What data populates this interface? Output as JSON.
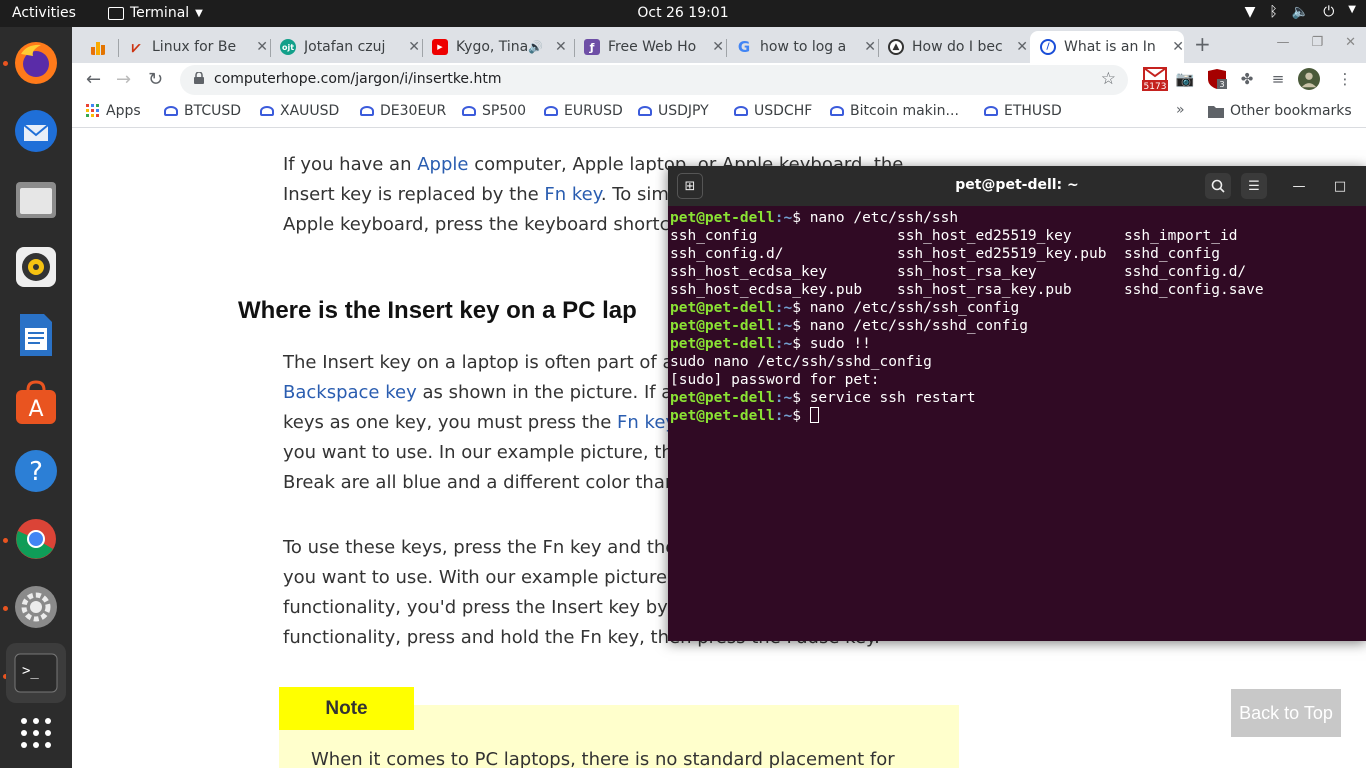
{
  "topbar": {
    "activities": "Activities",
    "app": "Terminal",
    "clock": "Oct 26  19:01"
  },
  "browser": {
    "tabs": [
      {
        "title": "Linux for Be",
        "fav_color": "#c31"
      },
      {
        "title": "Jotafan czuj",
        "fav_color": "#13a08a"
      },
      {
        "title": "Kygo, Tina",
        "fav_color": "#e00"
      },
      {
        "title": "Free Web Ho",
        "fav_color": "#6e4fa6"
      },
      {
        "title": "how to log a",
        "fav_color": "#4285f4"
      },
      {
        "title": "How do I bec",
        "fav_color": "#333"
      },
      {
        "title": "What is an In",
        "fav_color": "#1a4ed8"
      }
    ],
    "url": "computerhope.com/jargon/i/insertke.htm",
    "ext_badge_mail": "5173",
    "ext_badge_shield": "3",
    "bookmarks": [
      "Apps",
      "BTCUSD",
      "XAUUSD",
      "DE30EUR",
      "SP500",
      "EURUSD",
      "USDJPY",
      "USDCHF",
      "Bitcoin makin...",
      "ETHUSD"
    ],
    "other_bookmarks": "Other bookmarks"
  },
  "page": {
    "p1": [
      {
        "t": "If you have an "
      },
      {
        "t": "Apple",
        "link": true
      },
      {
        "t": " computer, Apple laptop, or Apple keyboard, the"
      }
    ],
    "p1_l2": [
      {
        "t": "Insert key is replaced by the "
      },
      {
        "t": "Fn key",
        "link": true
      },
      {
        "t": ". To sim"
      }
    ],
    "p1_l3": [
      {
        "t": "Apple keyboard, press the keyboard shortc"
      }
    ],
    "heading": "Where is the Insert key on a PC lap",
    "p2_l1": [
      {
        "t": "The Insert key on a laptop is often part of a"
      }
    ],
    "p2_l2": [
      {
        "t": "Backspace key",
        "link": true
      },
      {
        "t": " as shown in the picture. If a"
      }
    ],
    "p2_l3": [
      {
        "t": "keys as one key, you must press the "
      },
      {
        "t": "Fn key",
        "link": true
      }
    ],
    "p2_l4": [
      {
        "t": "you want to use. In our example picture, th"
      }
    ],
    "p2_l5": [
      {
        "t": "Break are all blue and a different color than"
      }
    ],
    "p3_l1": [
      {
        "t": "To use these keys, press the Fn key and the"
      }
    ],
    "p3_l2": [
      {
        "t": "you want to use. With our example picture,"
      }
    ],
    "p3_l3": [
      {
        "t": "functionality, you'd press the Insert key by"
      }
    ],
    "p3_l4": [
      {
        "t": "functionality, press and hold the Fn key, then press the Pause key."
      }
    ],
    "note_label": "Note",
    "note_text": "When it comes to PC laptops, there is no standard placement for",
    "back_to_top": "Back to Top"
  },
  "terminal": {
    "title": "pet@pet-dell: ~",
    "prompt_user": "pet@pet-dell",
    "prompt_path": ":~",
    "lines": [
      {
        "prompt": true,
        "cmd": "$ nano /etc/ssh/ssh"
      },
      {
        "prompt": false,
        "cmd": "ssh_config                ssh_host_ed25519_key      ssh_import_id"
      },
      {
        "prompt": false,
        "cmd": "ssh_config.d/             ssh_host_ed25519_key.pub  sshd_config"
      },
      {
        "prompt": false,
        "cmd": "ssh_host_ecdsa_key        ssh_host_rsa_key          sshd_config.d/"
      },
      {
        "prompt": false,
        "cmd": "ssh_host_ecdsa_key.pub    ssh_host_rsa_key.pub      sshd_config.save"
      },
      {
        "prompt": true,
        "cmd": "$ nano /etc/ssh/ssh_config"
      },
      {
        "prompt": true,
        "cmd": "$ nano /etc/ssh/sshd_config"
      },
      {
        "prompt": true,
        "cmd": "$ sudo !!"
      },
      {
        "prompt": false,
        "cmd": "sudo nano /etc/ssh/sshd_config"
      },
      {
        "prompt": false,
        "cmd": "[sudo] password for pet:"
      },
      {
        "prompt": true,
        "cmd": "$ service ssh restart"
      },
      {
        "prompt": true,
        "cmd": "$ ",
        "cursor": true
      }
    ]
  }
}
